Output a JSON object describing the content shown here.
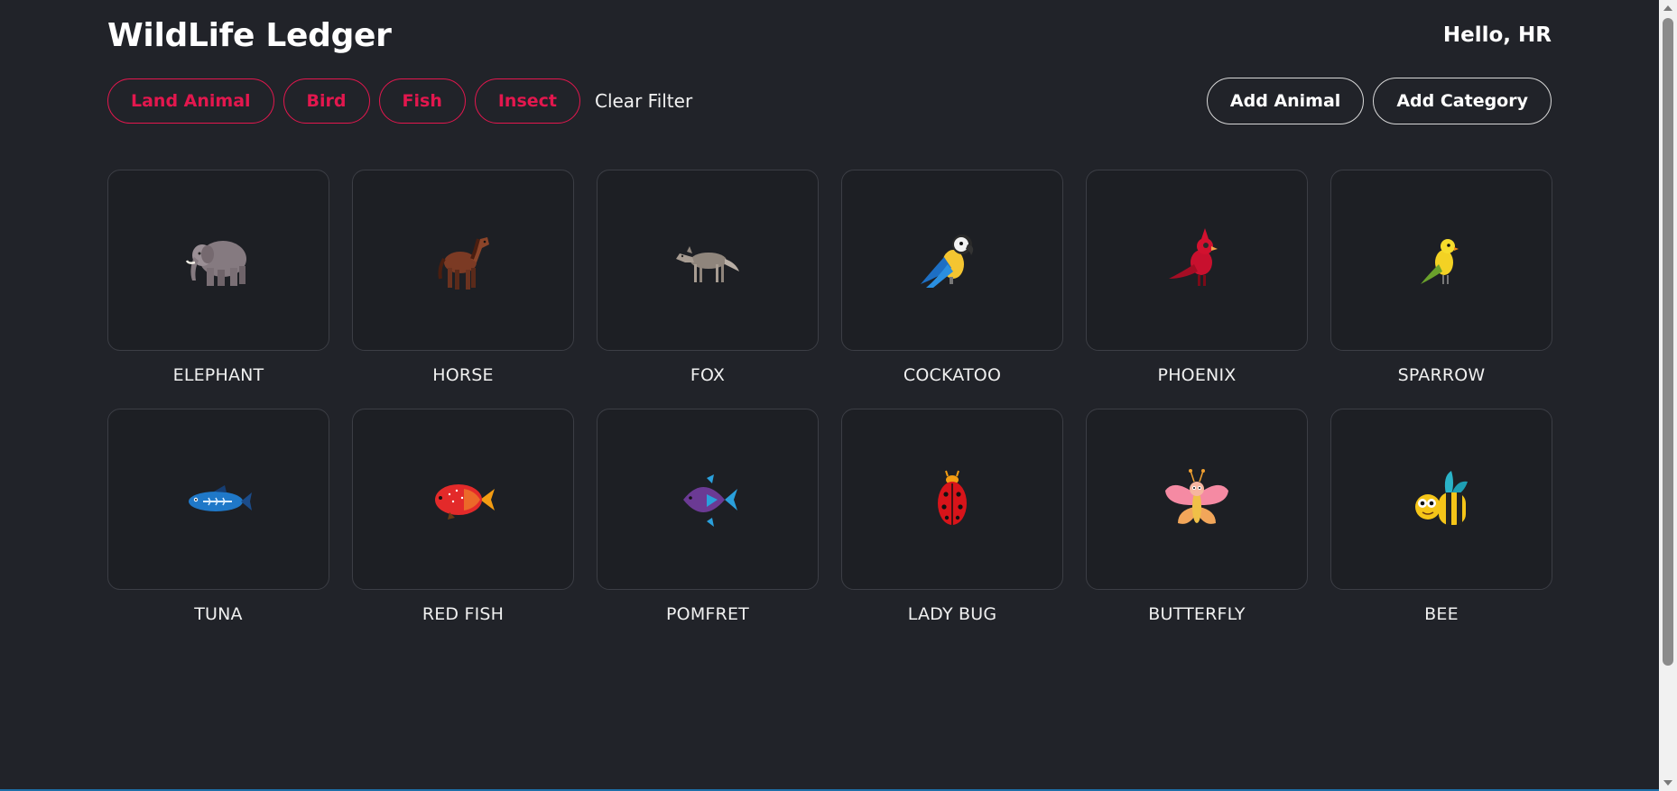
{
  "header": {
    "title": "WildLife Ledger",
    "greeting": "Hello, HR"
  },
  "filters": {
    "chips": [
      "Land Animal",
      "Bird",
      "Fish",
      "Insect"
    ],
    "clear_label": "Clear Filter",
    "accent_color": "#e3174e"
  },
  "actions": {
    "add_animal_label": "Add Animal",
    "add_category_label": "Add Category"
  },
  "animals": [
    {
      "name": "ELEPHANT",
      "icon": "elephant-icon"
    },
    {
      "name": "HORSE",
      "icon": "horse-icon"
    },
    {
      "name": "FOX",
      "icon": "fox-icon"
    },
    {
      "name": "COCKATOO",
      "icon": "cockatoo-icon"
    },
    {
      "name": "PHOENIX",
      "icon": "phoenix-icon"
    },
    {
      "name": "SPARROW",
      "icon": "sparrow-icon"
    },
    {
      "name": "TUNA",
      "icon": "tuna-icon"
    },
    {
      "name": "RED FISH",
      "icon": "red-fish-icon"
    },
    {
      "name": "POMFRET",
      "icon": "pomfret-icon"
    },
    {
      "name": "LADY BUG",
      "icon": "ladybug-icon"
    },
    {
      "name": "BUTTERFLY",
      "icon": "butterfly-icon"
    },
    {
      "name": "BEE",
      "icon": "bee-icon"
    }
  ],
  "theme": {
    "background": "#212329",
    "card_border": "#3c3e45"
  }
}
